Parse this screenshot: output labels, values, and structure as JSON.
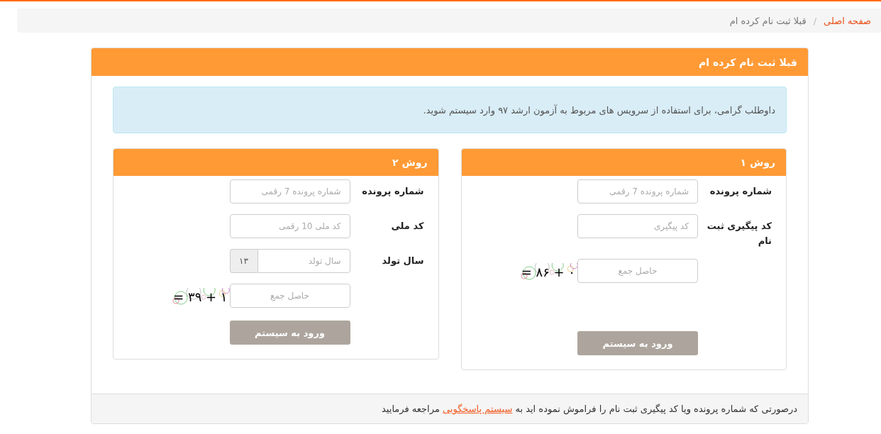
{
  "breadcrumb": {
    "separator": "/",
    "items": [
      {
        "label": "صفحه اصلی",
        "kind": "link"
      },
      {
        "label": "قبلا ثبت نام کرده ام",
        "kind": "current"
      }
    ]
  },
  "panel": {
    "title": "قبلا ثبت نام کرده ام",
    "notice": "داوطلب گرامی، برای استفاده از سرویس های مربوط به آزمون ارشد ۹۷ وارد سیستم شوید.",
    "methods": [
      {
        "title": "روش ۱",
        "fields": [
          {
            "kind": "text",
            "label": "شماره پرونده",
            "placeholder": "شماره پرونده 7 رقمی"
          },
          {
            "kind": "text",
            "label": "کد پیگیری ثبت نام",
            "placeholder": "کد پیگیری"
          },
          {
            "kind": "captcha",
            "placeholder": "حاصل جمع",
            "captcha": "= ۸۶ + ۰"
          }
        ],
        "button": "ورود به سیستم"
      },
      {
        "title": "روش ۲",
        "fields": [
          {
            "kind": "text",
            "label": "شماره پرونده",
            "placeholder": "شماره پرونده 7 رقمی"
          },
          {
            "kind": "text",
            "label": "کد ملی",
            "placeholder": "کد ملی 10 رقمی"
          },
          {
            "kind": "addon",
            "label": "سال تولد",
            "placeholder": "سال تولد",
            "addon": "۱۳"
          },
          {
            "kind": "captcha",
            "placeholder": "حاصل جمع",
            "captcha": "= ۳۹ + ۱"
          }
        ],
        "button": "ورود به سیستم"
      }
    ],
    "footer": {
      "text_before": "درصورتی که شماره پرونده ویا کد پیگیری ثبت نام را فراموش نموده اید به ",
      "link": "سیستم پاسخگویی",
      "text_after": " مراجعه فرمایید"
    }
  }
}
